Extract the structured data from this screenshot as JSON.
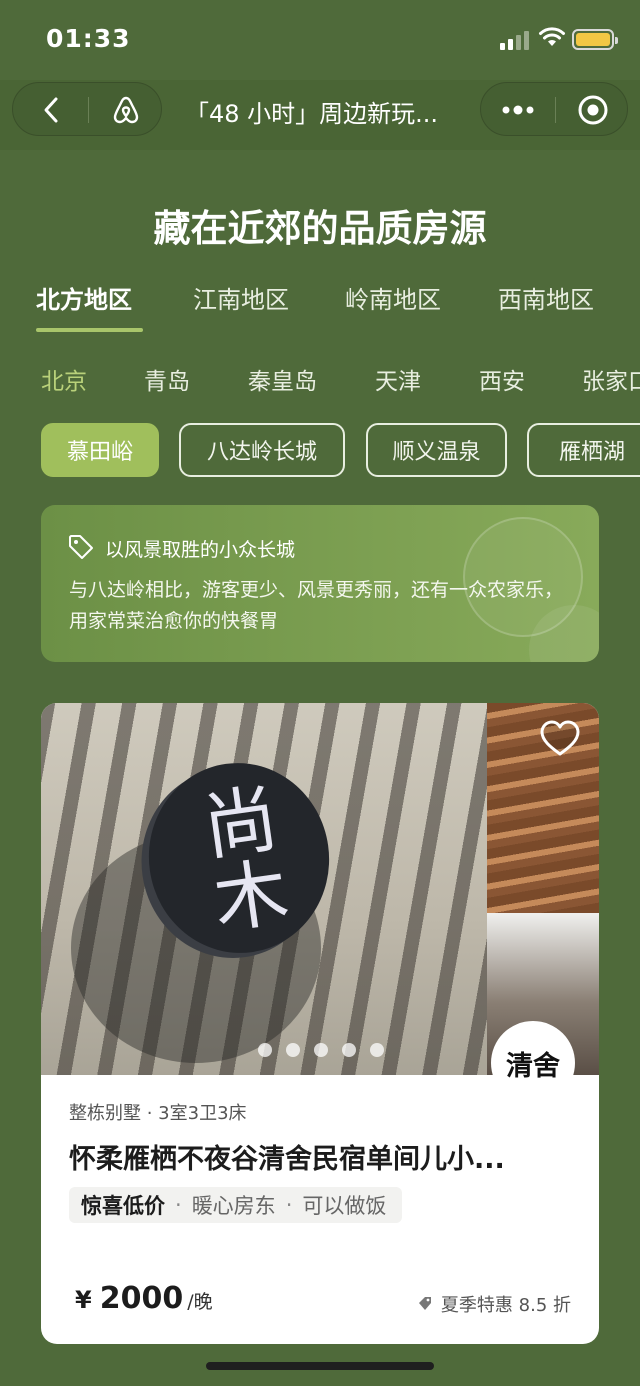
{
  "status_bar": {
    "time": "01:33"
  },
  "nav": {
    "title": "「48 小时」周边新玩..."
  },
  "page_title": "藏在近郊的品质房源",
  "region_tabs": [
    "北方地区",
    "江南地区",
    "岭南地区",
    "西南地区"
  ],
  "city_tabs": [
    "北京",
    "青岛",
    "秦皇岛",
    "天津",
    "西安",
    "张家口"
  ],
  "area_chips": [
    "慕田峪",
    "八达岭长城",
    "顺义温泉",
    "雁栖湖"
  ],
  "promo": {
    "headline": "以风景取胜的小众长城",
    "body": "与八达岭相比，游客更少、风景更秀丽，还有一众农家乐，用家常菜治愈你的快餐胃"
  },
  "listing": {
    "sign_text": "尚木",
    "host_badge": "清舍",
    "meta": "整栋别墅 · 3室3卫3床",
    "title": "怀柔雁栖不夜谷清舍民宿单间儿小...",
    "tag_primary": "惊喜低价",
    "tag_2": "暖心房东",
    "tag_3": "可以做饭",
    "price_symbol": "¥",
    "price": "2000",
    "price_unit": "/晚",
    "discount": "夏季特惠 8.5 折",
    "photo_count": 5
  },
  "colors": {
    "background": "#4f6a3a",
    "accent": "#a0bf5c",
    "active_city": "#b9d17a"
  }
}
